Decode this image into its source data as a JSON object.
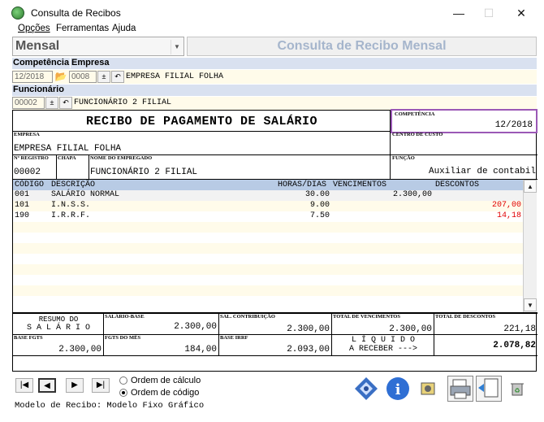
{
  "window": {
    "title": "Consulta de Recibos",
    "minimize": "—",
    "maximize": "☐",
    "close": "✕"
  },
  "menu": [
    {
      "label": "Opções"
    },
    {
      "label": "Ferramentas"
    },
    {
      "label": "Ajuda"
    }
  ],
  "mode": {
    "value": "Mensal",
    "title": "Consulta de Recibo Mensal"
  },
  "filters": {
    "competencia_label": "Competência",
    "empresa_label": "Empresa",
    "competencia_value": "12/2018",
    "empresa_code": "0008",
    "empresa_name": "EMPRESA FILIAL FOLHA",
    "funcionario_label": "Funcionário",
    "funcionario_code": "00002",
    "funcionario_name": "FUNCIONÁRIO 2 FILIAL"
  },
  "receipt": {
    "title": "RECIBO DE PAGAMENTO DE SALÁRIO",
    "competencia_label": "COMPETÊNCIA",
    "competencia_value": "12/2018",
    "empresa_label": "EMPRESA",
    "empresa_value": "EMPRESA FILIAL FOLHA",
    "centro_label": "CENTRO DE CUSTO",
    "registro_label": "Nº REGISTRO",
    "chapa_label": "CHAPA",
    "nome_label": "NOME DO EMPREGADO",
    "registro_value": "00002",
    "nome_value": "FUNCIONÁRIO 2 FILIAL",
    "funcao_label": "FUNÇÃO",
    "funcao_value": "Auxiliar de contabil",
    "columns": [
      "CÓDIGO",
      "DESCRIÇÃO",
      "HORAS/DIAS",
      "VENCIMENTOS",
      "DESCONTOS"
    ],
    "rows": [
      {
        "codigo": "001",
        "descricao": "SALÁRIO NORMAL",
        "horas": "30.00",
        "vencimentos": "2.300,00",
        "descontos": ""
      },
      {
        "codigo": "101",
        "descricao": "I.N.S.S.",
        "horas": "9.00",
        "vencimentos": "",
        "descontos": "207,00"
      },
      {
        "codigo": "190",
        "descricao": "I.R.R.F.",
        "horas": "7.50",
        "vencimentos": "",
        "descontos": "14,18"
      }
    ],
    "resumo_line1": "RESUMO DO",
    "resumo_line2": "S A L Á R I O",
    "salario_base_label": "SALÁRIO-BASE",
    "salario_base": "2.300,00",
    "sal_contrib_label": "SAL. CONTRIBUIÇÃO",
    "sal_contrib": "2.300,00",
    "total_venc_label": "TOTAL DE VENCIMENTOS",
    "total_venc": "2.300,00",
    "total_desc_label": "TOTAL DE DESCONTOS",
    "total_desc": "221,18",
    "base_fgts_label": "BASE FGTS",
    "base_fgts": "2.300,00",
    "fgts_mes_label": "FGTS DO MÊS",
    "fgts_mes": "184,00",
    "base_irrf_label": "BASE IRRF",
    "base_irrf": "2.093,00",
    "liquido_line1": "L Í Q U I D O",
    "liquido_line2": "A RECEBER --->",
    "liquido": "2.078,82"
  },
  "bottom": {
    "order_calc": "Ordem de cálculo",
    "order_code": "Ordem de código",
    "status": "Modelo de Recibo: Modelo Fixo Gráfico"
  },
  "colors": {
    "accent_purple": "#9b59b6",
    "desconto_red": "#e00000",
    "header_blue": "#b8cbe5",
    "field_yellow": "#fffbea"
  }
}
